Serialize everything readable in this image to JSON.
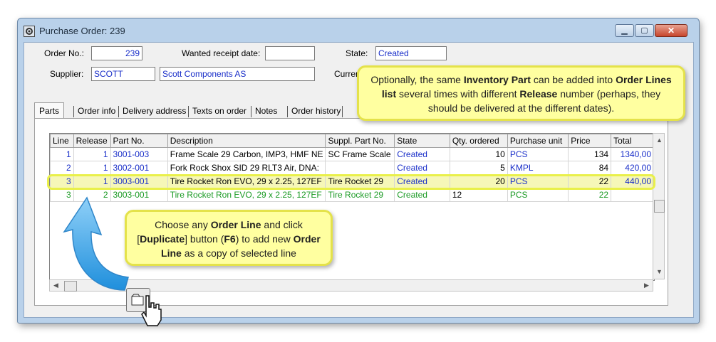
{
  "window": {
    "title": "Purchase Order: 239"
  },
  "form": {
    "order_no_label": "Order No.:",
    "order_no": "239",
    "wanted_date_label": "Wanted receipt date:",
    "wanted_date": "",
    "state_label": "State:",
    "state": "Created",
    "supplier_label": "Supplier:",
    "supplier_code": "SCOTT",
    "supplier_name": "Scott Components AS",
    "currency_label": "Curren"
  },
  "tabs": [
    "Parts",
    "Order info",
    "Delivery address",
    "Texts on order",
    "Notes",
    "Order history"
  ],
  "grid": {
    "columns": [
      "Line",
      "Release",
      "Part No.",
      "Description",
      "Suppl. Part No.",
      "State",
      "Qty. ordered",
      "Purchase unit",
      "Price",
      "Total"
    ],
    "rows": [
      {
        "line": "1",
        "release": "1",
        "part_no": "3001-003",
        "description": "Frame Scale 29 Carbon, IMP3, HMF NE",
        "suppl_part_no": "SC Frame Scale",
        "state": "Created",
        "qty": "10",
        "unit": "PCS",
        "price": "134",
        "total": "1340,00"
      },
      {
        "line": "2",
        "release": "1",
        "part_no": "3002-001",
        "description": "Fork Rock Shox SID 29 RLT3 Air, DNA:",
        "suppl_part_no": "",
        "state": "Created",
        "qty": "5",
        "unit": "KMPL",
        "price": "84",
        "total": "420,00"
      },
      {
        "line": "3",
        "release": "1",
        "part_no": "3003-001",
        "description": "Tire Rocket Ron EVO, 29 x 2.25, 127EF",
        "suppl_part_no": "Tire Rocket 29",
        "state": "Created",
        "qty": "20",
        "unit": "PCS",
        "price": "22",
        "total": "440,00"
      },
      {
        "line": "3",
        "release": "2",
        "part_no": "3003-001",
        "description": "Tire Rocket Ron EVO, 29 x 2.25, 127EF",
        "suppl_part_no": "Tire Rocket 29",
        "state": "Created",
        "qty": "12",
        "unit": "PCS",
        "price": "22",
        "total": ""
      }
    ]
  },
  "callout_top": {
    "p1": "Optionally, the same ",
    "b1": "Inventory Part",
    "p2": " can be added into ",
    "b2": "Order Lines list",
    "p3": " several times with different ",
    "b3": "Release",
    "p4": " number (perhaps, they should be delivered at the different dates)."
  },
  "callout_bottom": {
    "p1": "Choose any ",
    "b1": "Order Line",
    "p2": " and click [",
    "b2": "Duplicate",
    "p3": "] button (",
    "b3": "F6",
    "p4": ") to add new ",
    "b4": "Order Line",
    "p5": " as a copy of selected line"
  },
  "colors": {
    "accent": "#1a2fc9",
    "new_line": "#1a9a24",
    "callout_fill": "#ffffa0",
    "arrow": "#3aa6e8"
  },
  "icons": {
    "window": "gear-app-icon",
    "duplicate": "duplicate-icon",
    "cursor": "hand-cursor-icon"
  }
}
